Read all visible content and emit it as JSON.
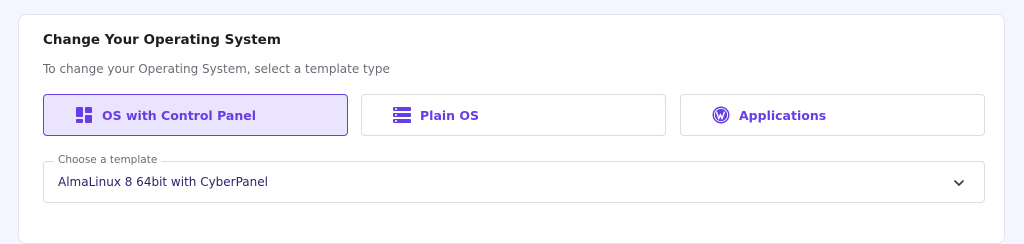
{
  "section": {
    "title": "Change Your Operating System",
    "subtitle": "To change your Operating System, select a template type"
  },
  "tabs": [
    {
      "label": "OS with Control Panel",
      "icon": "dashboard-grid-icon",
      "active": true
    },
    {
      "label": "Plain OS",
      "icon": "server-list-icon",
      "active": false
    },
    {
      "label": "Applications",
      "icon": "wordpress-icon",
      "active": false
    }
  ],
  "template_select": {
    "label": "Choose a template",
    "value": "AlmaLinux 8 64bit with CyberPanel",
    "icon": "chevron-down-icon"
  },
  "colors": {
    "accent": "#673de6",
    "active_tab_bg": "#ebe4ff",
    "page_bg": "#f4f5ff"
  }
}
